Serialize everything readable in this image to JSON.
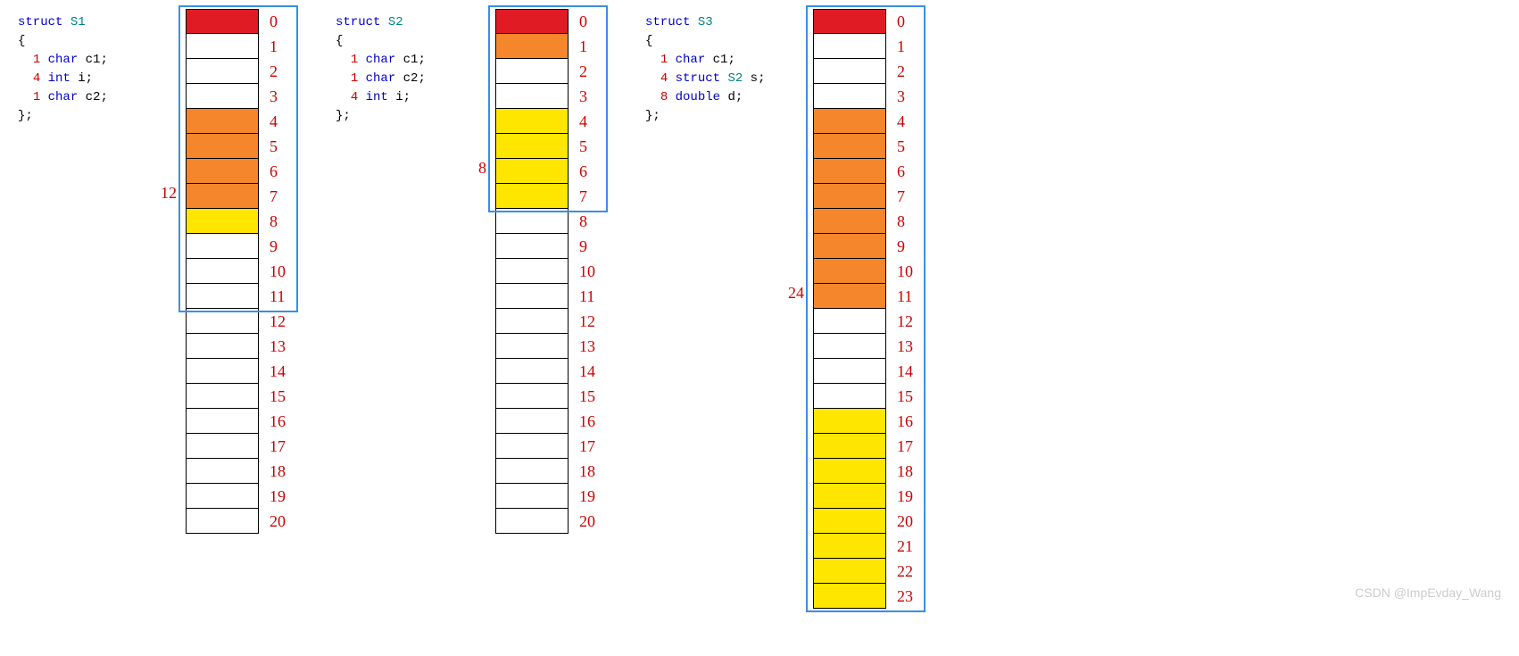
{
  "watermark": "CSDN @ImpEvday_Wang",
  "structs": [
    {
      "name": "S1",
      "keyword": "struct",
      "open": "{",
      "close": "};",
      "members": [
        {
          "size": "1",
          "type_kw": "char",
          "name": "c1;"
        },
        {
          "size": "4",
          "type_kw": "int",
          "name": "i;"
        },
        {
          "size": "1",
          "type_kw": "char",
          "name": "c2;"
        }
      ],
      "total_size": "12",
      "total_size_row": 7,
      "highlight_rows": 12,
      "cells": [
        {
          "i": "0",
          "c": "red"
        },
        {
          "i": "1",
          "c": "white"
        },
        {
          "i": "2",
          "c": "white"
        },
        {
          "i": "3",
          "c": "white"
        },
        {
          "i": "4",
          "c": "orange"
        },
        {
          "i": "5",
          "c": "orange"
        },
        {
          "i": "6",
          "c": "orange"
        },
        {
          "i": "7",
          "c": "orange"
        },
        {
          "i": "8",
          "c": "yellow"
        },
        {
          "i": "9",
          "c": "white"
        },
        {
          "i": "10",
          "c": "white"
        },
        {
          "i": "11",
          "c": "white"
        },
        {
          "i": "12",
          "c": "white"
        },
        {
          "i": "13",
          "c": "white"
        },
        {
          "i": "14",
          "c": "white"
        },
        {
          "i": "15",
          "c": "white"
        },
        {
          "i": "16",
          "c": "white"
        },
        {
          "i": "17",
          "c": "white"
        },
        {
          "i": "18",
          "c": "white"
        },
        {
          "i": "19",
          "c": "white"
        },
        {
          "i": "20",
          "c": "white"
        }
      ]
    },
    {
      "name": "S2",
      "keyword": "struct",
      "open": "{",
      "close": "};",
      "members": [
        {
          "size": "1",
          "type_kw": "char",
          "name": "c1;"
        },
        {
          "size": "1",
          "type_kw": "char",
          "name": "c2;"
        },
        {
          "size": "4",
          "type_kw": "int",
          "name": "i;"
        }
      ],
      "total_size": "8",
      "total_size_row": 6,
      "highlight_rows": 8,
      "cells": [
        {
          "i": "0",
          "c": "red"
        },
        {
          "i": "1",
          "c": "orange"
        },
        {
          "i": "2",
          "c": "white"
        },
        {
          "i": "3",
          "c": "white"
        },
        {
          "i": "4",
          "c": "yellow"
        },
        {
          "i": "5",
          "c": "yellow"
        },
        {
          "i": "6",
          "c": "yellow"
        },
        {
          "i": "7",
          "c": "yellow"
        },
        {
          "i": "8",
          "c": "white"
        },
        {
          "i": "9",
          "c": "white"
        },
        {
          "i": "10",
          "c": "white"
        },
        {
          "i": "11",
          "c": "white"
        },
        {
          "i": "12",
          "c": "white"
        },
        {
          "i": "13",
          "c": "white"
        },
        {
          "i": "14",
          "c": "white"
        },
        {
          "i": "15",
          "c": "white"
        },
        {
          "i": "16",
          "c": "white"
        },
        {
          "i": "17",
          "c": "white"
        },
        {
          "i": "18",
          "c": "white"
        },
        {
          "i": "19",
          "c": "white"
        },
        {
          "i": "20",
          "c": "white"
        }
      ]
    },
    {
      "name": "S3",
      "keyword": "struct",
      "open": "{",
      "close": "};",
      "members": [
        {
          "size": "1",
          "type_kw": "char",
          "name": "c1;"
        },
        {
          "size": "4",
          "type_kw": "struct",
          "type_extra": "S2",
          "name": "s;"
        },
        {
          "size": "8",
          "type_kw": "double",
          "name": "d;"
        }
      ],
      "total_size": "24",
      "total_size_row": 11,
      "highlight_rows": 24,
      "cells": [
        {
          "i": "0",
          "c": "red"
        },
        {
          "i": "1",
          "c": "white"
        },
        {
          "i": "2",
          "c": "white"
        },
        {
          "i": "3",
          "c": "white"
        },
        {
          "i": "4",
          "c": "orange"
        },
        {
          "i": "5",
          "c": "orange"
        },
        {
          "i": "6",
          "c": "orange"
        },
        {
          "i": "7",
          "c": "orange"
        },
        {
          "i": "8",
          "c": "orange"
        },
        {
          "i": "9",
          "c": "orange"
        },
        {
          "i": "10",
          "c": "orange"
        },
        {
          "i": "11",
          "c": "orange"
        },
        {
          "i": "12",
          "c": "white"
        },
        {
          "i": "13",
          "c": "white"
        },
        {
          "i": "14",
          "c": "white"
        },
        {
          "i": "15",
          "c": "white"
        },
        {
          "i": "16",
          "c": "yellow"
        },
        {
          "i": "17",
          "c": "yellow"
        },
        {
          "i": "18",
          "c": "yellow"
        },
        {
          "i": "19",
          "c": "yellow"
        },
        {
          "i": "20",
          "c": "yellow"
        },
        {
          "i": "21",
          "c": "yellow"
        },
        {
          "i": "22",
          "c": "yellow"
        },
        {
          "i": "23",
          "c": "yellow"
        }
      ]
    }
  ]
}
